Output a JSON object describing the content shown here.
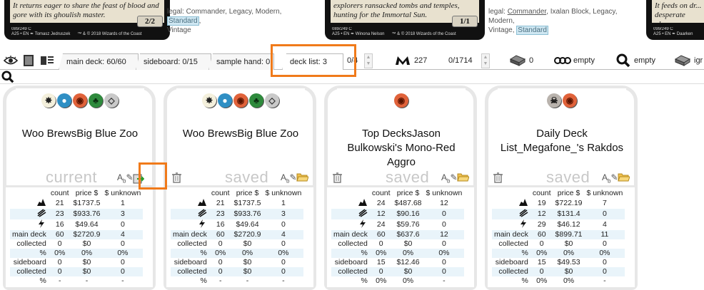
{
  "cards": [
    {
      "text": "It returns eager to share the feast of blood and gore with its ghoulish master.",
      "pt": "2/2",
      "credit": "089/249 C\nA25 • EN ✒ Tomasz Jedruszek      ™ & © 2018 Wizards of the Coast"
    },
    {
      "text": "explorers ransacked tombs and temples, hunting for the Immortal Sun.",
      "pt": "1/1",
      "credit": "089/249 C\nA25 • EN ✒ Winona Nelson      ™ & © 2018 Wizards of the Coast"
    },
    {
      "text": "It feeds on dr... desperate plea...",
      "credit": "099/249 C\nA25 • EN ✒ Daarken"
    }
  ],
  "legal": [
    {
      "prefix": "legal: Commander, Legacy, Modern, ",
      "highlight": "Standard",
      "suffix": ",",
      "line2": "Vintage"
    },
    {
      "prefix": "legal: ",
      "highlight_a": "Commander",
      "mid": ", Ixalan Block, Legacy, Modern,",
      "line2_pre": "Vintage, ",
      "highlight": "Standard"
    }
  ],
  "tabs": {
    "main_deck": "main deck: 60/60",
    "sideboard": "sideboard: 0/15",
    "sample_hand": "sample hand: 0",
    "deck_list": "deck list: 3",
    "deck_list_page": "0/4"
  },
  "stats": {
    "collection_count": "227",
    "collection_range": "0/1714",
    "tokens": "0",
    "filter_label": "empty",
    "search_label": "empty",
    "ignore_label": "igr"
  },
  "search": {
    "value": ""
  },
  "table_headers": [
    "count",
    "price $",
    "$ unknown"
  ],
  "row_labels": {
    "main_deck": "main deck",
    "collected": "collected",
    "pct": "%",
    "sideboard": "sideboard"
  },
  "decks": [
    {
      "title": "Woo BrewsBig Blue Zoo",
      "state": "current",
      "colors": [
        "w",
        "u",
        "r",
        "g",
        "c"
      ],
      "rows": {
        "creatures": [
          "21",
          "$1737.5",
          "1"
        ],
        "spells": [
          "23",
          "$933.76",
          "3"
        ],
        "lands": [
          "16",
          "$49.64",
          "0"
        ],
        "main": [
          "60",
          "$2720.9",
          "4"
        ],
        "main_collected": [
          "0",
          "$0",
          "0"
        ],
        "main_pct": [
          "0%",
          "0%",
          "0%"
        ],
        "side": [
          "0",
          "$0",
          "0"
        ],
        "side_collected": [
          "0",
          "$0",
          "0"
        ],
        "side_pct": [
          "-",
          "-",
          "-"
        ]
      }
    },
    {
      "title": "Woo BrewsBig Blue Zoo",
      "state": "saved",
      "colors": [
        "w",
        "u",
        "r",
        "g",
        "c"
      ],
      "rows": {
        "creatures": [
          "21",
          "$1737.5",
          "1"
        ],
        "spells": [
          "23",
          "$933.76",
          "3"
        ],
        "lands": [
          "16",
          "$49.64",
          "0"
        ],
        "main": [
          "60",
          "$2720.9",
          "4"
        ],
        "main_collected": [
          "0",
          "$0",
          "0"
        ],
        "main_pct": [
          "0%",
          "0%",
          "0%"
        ],
        "side": [
          "0",
          "$0",
          "0"
        ],
        "side_collected": [
          "0",
          "$0",
          "0"
        ],
        "side_pct": [
          "-",
          "-",
          "-"
        ]
      }
    },
    {
      "title": "Top DecksJason Bulkowski's Mono-Red Aggro",
      "state": "saved",
      "colors": [
        "r"
      ],
      "rows": {
        "creatures": [
          "24",
          "$487.68",
          "12"
        ],
        "spells": [
          "12",
          "$90.16",
          "0"
        ],
        "lands": [
          "24",
          "$59.76",
          "0"
        ],
        "main": [
          "60",
          "$637.6",
          "12"
        ],
        "main_collected": [
          "0",
          "$0",
          "0"
        ],
        "main_pct": [
          "0%",
          "0%",
          "0%"
        ],
        "side": [
          "15",
          "$12.46",
          "0"
        ],
        "side_collected": [
          "0",
          "$0",
          "0"
        ],
        "side_pct": [
          "0%",
          "0%",
          "-"
        ]
      }
    },
    {
      "title": "Daily Deck List_Megafone_'s Rakdos",
      "state": "saved",
      "colors": [
        "b",
        "r"
      ],
      "rows": {
        "creatures": [
          "19",
          "$722.19",
          "7"
        ],
        "spells": [
          "12",
          "$131.4",
          "0"
        ],
        "lands": [
          "29",
          "$46.12",
          "4"
        ],
        "main": [
          "60",
          "$899.71",
          "11"
        ],
        "main_collected": [
          "0",
          "$0",
          "0"
        ],
        "main_pct": [
          "0%",
          "0%",
          "0%"
        ],
        "side": [
          "15",
          "$49.53",
          "0"
        ],
        "side_collected": [
          "0",
          "$0",
          "0"
        ],
        "side_pct": [
          "0%",
          "0%",
          "-"
        ]
      }
    }
  ],
  "colors": {
    "highlight": "#f07a1a",
    "tab_border": "#b8b8b8",
    "deck_frame": "#e7e7e7",
    "row_alt": "#e9f4fa"
  },
  "icons": [
    "eye-icon",
    "view-stack-icon",
    "view-list-icon",
    "mtg-logo-icon",
    "collection-box-icon",
    "filter-chain-icon",
    "magnifier-icon",
    "ignore-box-icon",
    "trash-icon",
    "rename-icon",
    "export-icon",
    "folder-icon"
  ]
}
